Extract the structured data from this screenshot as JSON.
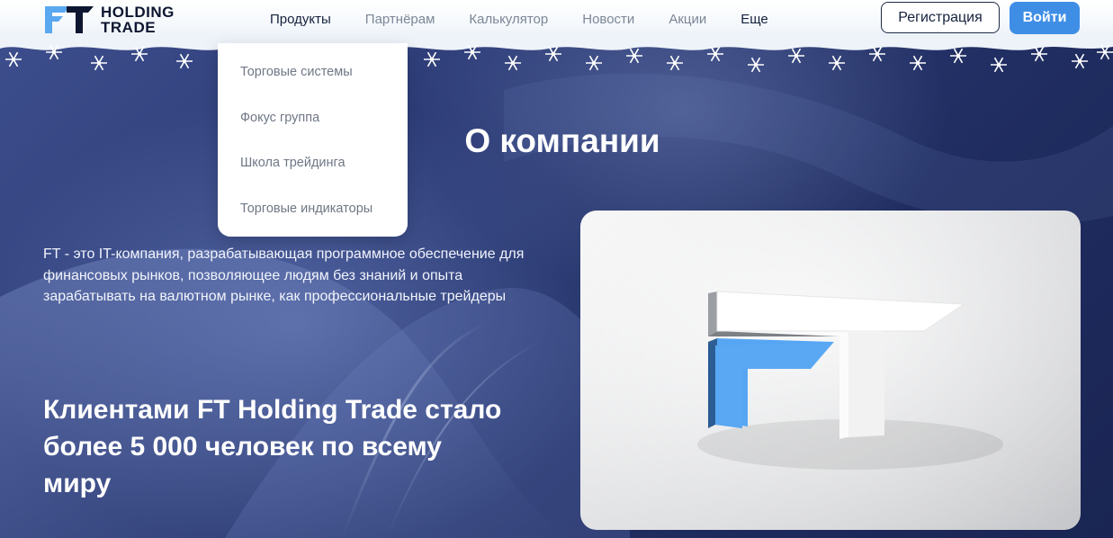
{
  "header": {
    "logo": {
      "line1": "HOLDING",
      "line2": "TRADE",
      "mark": "FT"
    },
    "nav": [
      {
        "label": "Продукты"
      },
      {
        "label": "Партнёрам"
      },
      {
        "label": "Калькулятор"
      },
      {
        "label": "Новости"
      },
      {
        "label": "Акции"
      },
      {
        "label": "Еще"
      }
    ],
    "register_label": "Регистрация",
    "login_label": "Войти"
  },
  "dropdown": {
    "items": [
      {
        "label": "Торговые системы"
      },
      {
        "label": "Фокус группа"
      },
      {
        "label": "Школа трейдинга"
      },
      {
        "label": "Торговые индикаторы"
      }
    ]
  },
  "main": {
    "title": "О компании",
    "description": "FT - это IT-компания, разрабатывающая программное обеспечение для финансовых рынков, позволяющее людям без знаний и опыта зарабатывать на валютном рынке, как профессиональные трейдеры",
    "headline": "Клиентами FT Holding Trade стало более 5 000 человек по всему миру",
    "card_logo": "FT"
  },
  "colors": {
    "accent": "#3f8ee6",
    "logo_blue": "#5aa8f0",
    "background": "#243264"
  },
  "icons": [
    "ft-logo-icon",
    "snowflake-icon",
    "ft-3d-logo-icon"
  ]
}
